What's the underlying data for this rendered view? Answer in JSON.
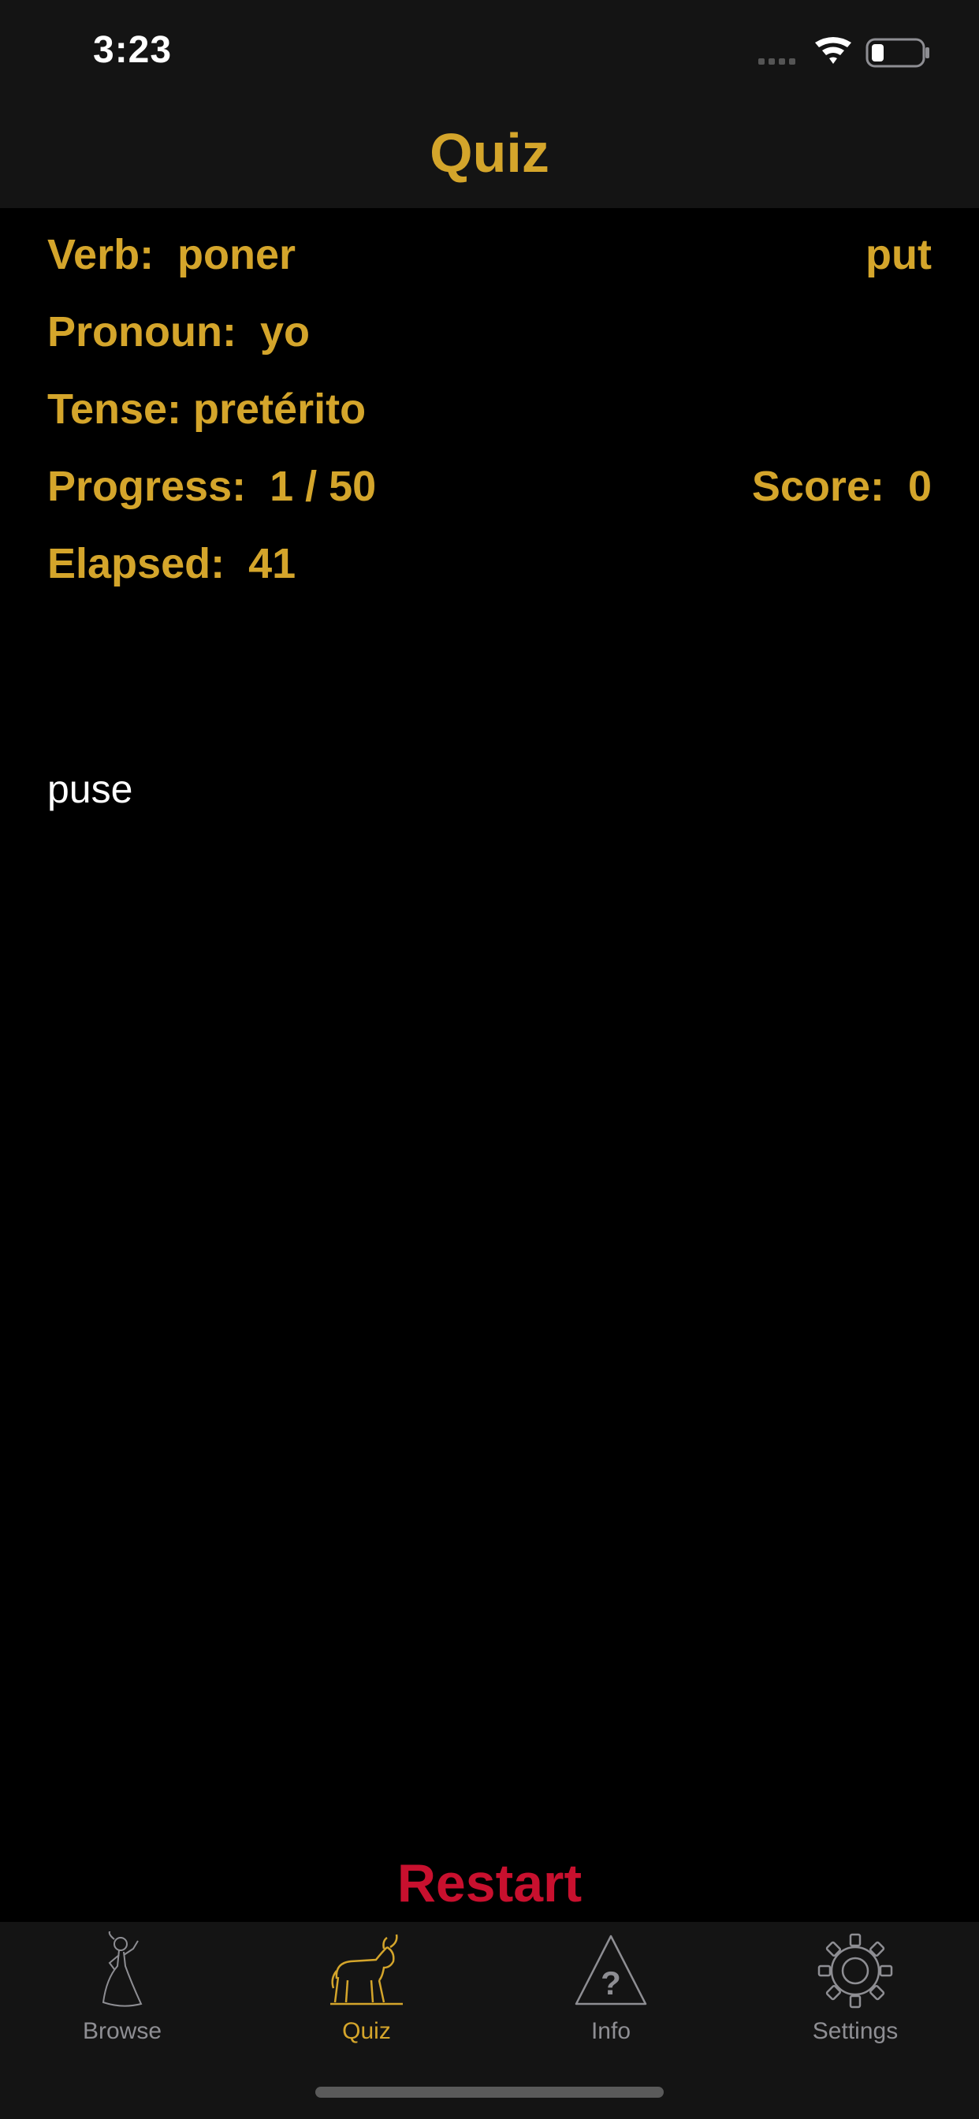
{
  "status_bar": {
    "time": "3:23"
  },
  "nav": {
    "title": "Quiz"
  },
  "quiz": {
    "verb_label": "Verb:  poner",
    "verb_translation": "put",
    "pronoun_label": "Pronoun:  yo",
    "tense_label": "Tense: pretérito",
    "progress_label": "Progress:  1 / 50",
    "score_label": "Score:  0",
    "elapsed_label": "Elapsed:  41",
    "answer": "puse"
  },
  "actions": {
    "restart_label": "Restart"
  },
  "tab_bar": {
    "tabs": [
      {
        "label": "Browse",
        "icon": "dancer-icon",
        "active": false
      },
      {
        "label": "Quiz",
        "icon": "bull-icon",
        "active": true
      },
      {
        "label": "Info",
        "icon": "warning-question-icon",
        "active": false
      },
      {
        "label": "Settings",
        "icon": "gear-icon",
        "active": false
      }
    ]
  },
  "colors": {
    "accent": "#d4a52b",
    "restart": "#c8102e",
    "inactive_tab": "#8e8e93",
    "bar_background": "#141414",
    "background": "#000000"
  }
}
